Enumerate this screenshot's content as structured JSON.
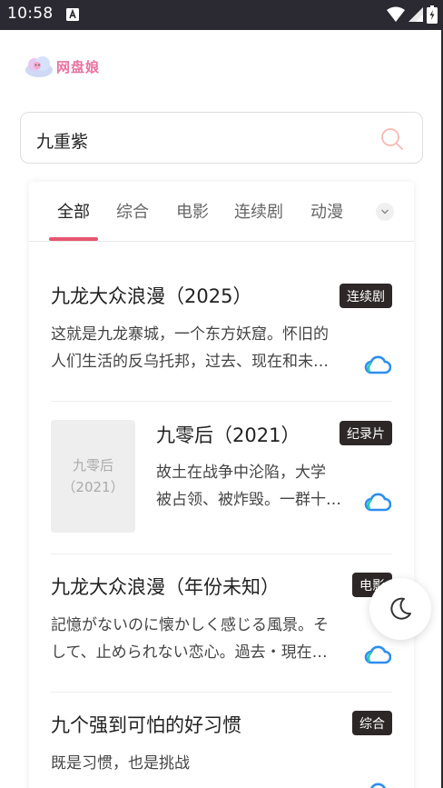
{
  "status_bar": {
    "time": "10:58",
    "icons": [
      "notification-a-icon",
      "wifi-icon",
      "signal-icon",
      "battery-icon"
    ]
  },
  "logo": {
    "text": "网盘娘"
  },
  "search": {
    "query": "九重紫",
    "icon": "search-icon"
  },
  "tabs": [
    {
      "label": "全部",
      "active": true
    },
    {
      "label": "综合",
      "active": false
    },
    {
      "label": "电影",
      "active": false
    },
    {
      "label": "连续剧",
      "active": false
    },
    {
      "label": "动漫",
      "active": false
    }
  ],
  "results": [
    {
      "title": "九龙大众浪漫（2025）",
      "badge": "连续剧",
      "desc_line1": "这就是九龙寨城，一个东方妖窟。怀旧的",
      "desc_line2": "人们生活的反乌托邦，过去、现在和未…"
    },
    {
      "title": "九零后（2021）",
      "badge": "纪录片",
      "thumb_line1": "九零后",
      "thumb_line2": "（2021）",
      "desc_line1": "故土在战争中沦陷，大学",
      "desc_line2": "被占领、被炸毁。一群十…"
    },
    {
      "title": "九龙大众浪漫（年份未知）",
      "badge": "电影",
      "desc_line1": "記憶がないのに懐かしく感じる風景。そ",
      "desc_line2": "して、止められない恋心。過去・現在…"
    },
    {
      "title": "九个强到可怕的好习惯",
      "badge": "综合",
      "desc_line1": "既是习惯，也是挑战"
    }
  ],
  "colors": {
    "accent": "#e5566e",
    "badge_bg": "#2e2727",
    "status_bar": "#2b2a33",
    "logo": "#e873a0"
  }
}
